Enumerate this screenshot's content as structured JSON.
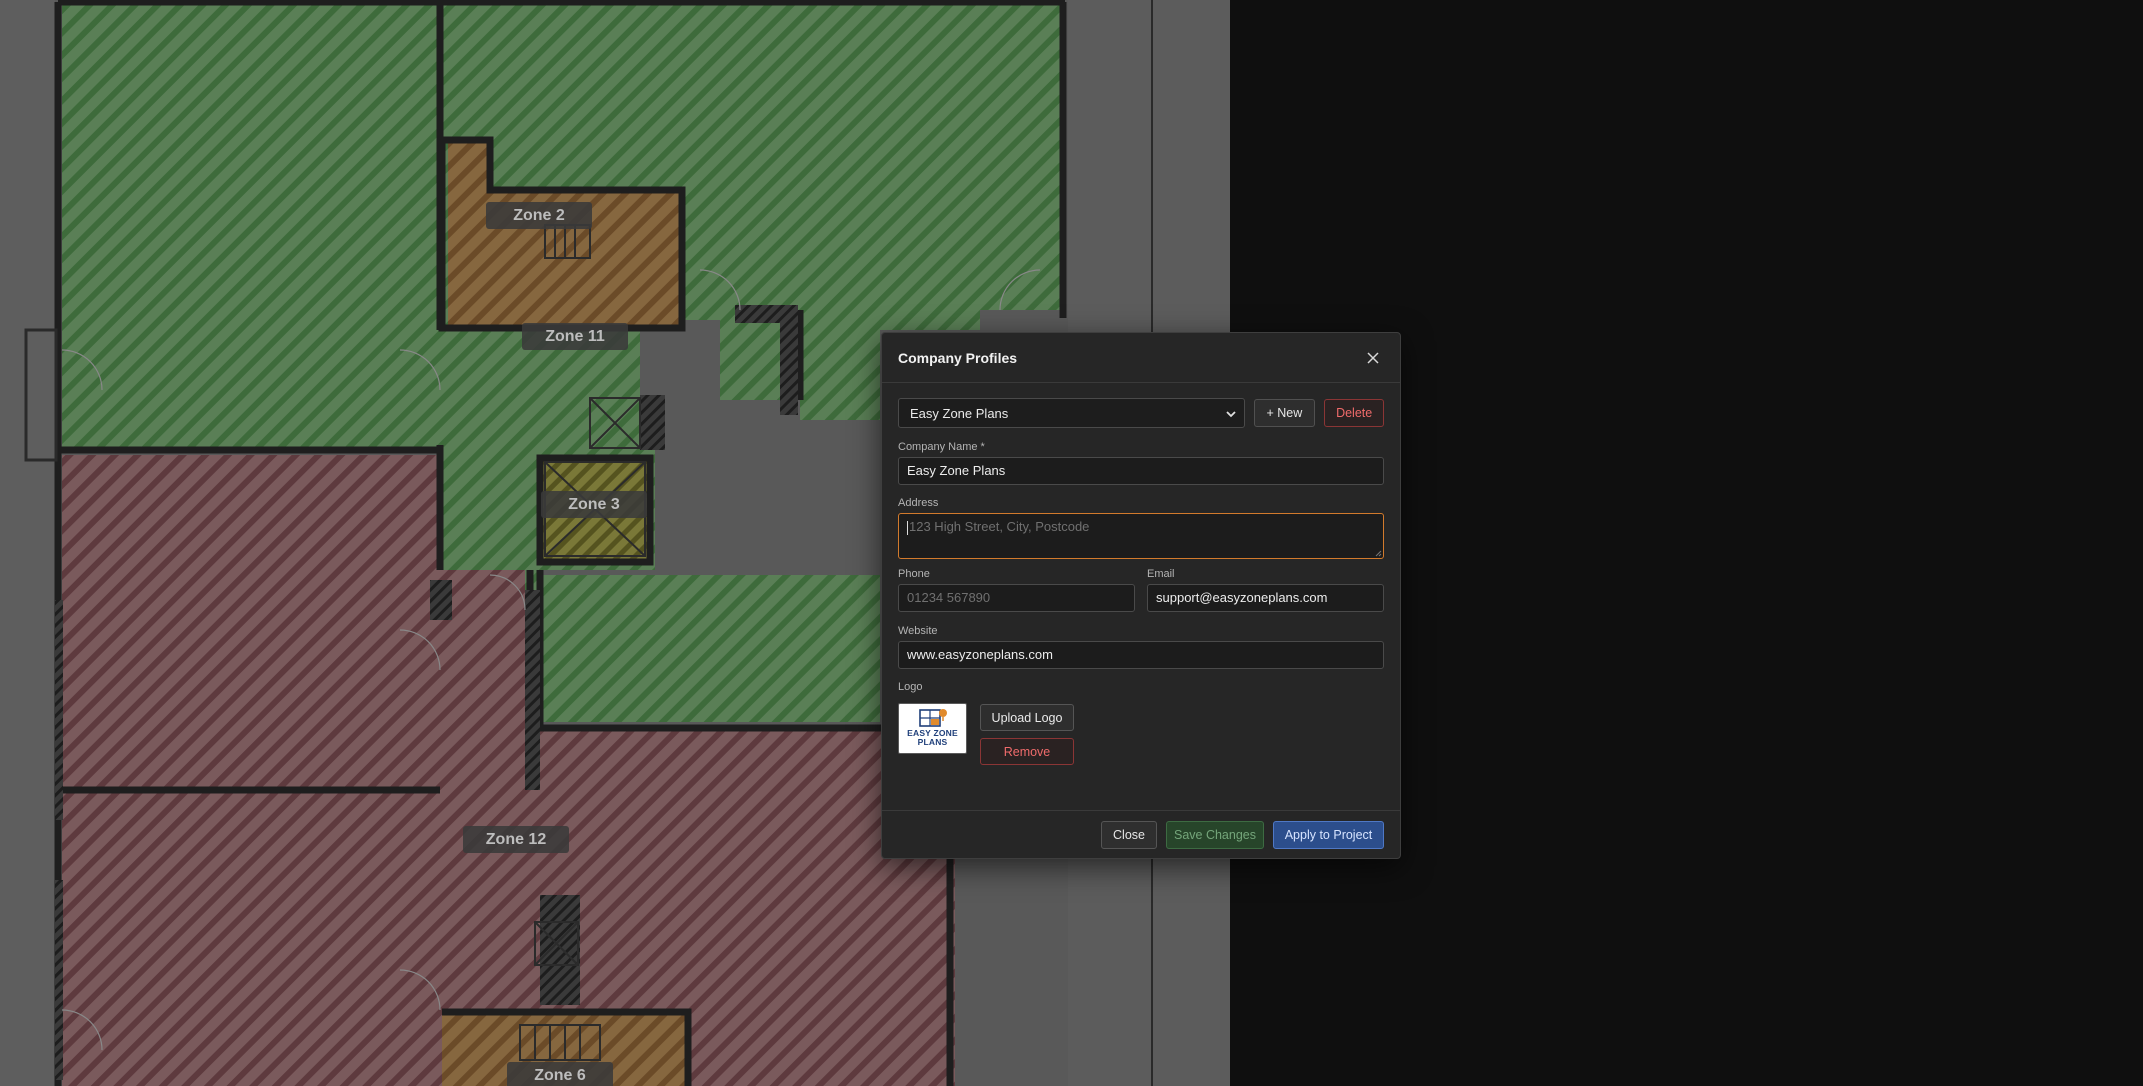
{
  "floorplan": {
    "zones": [
      {
        "label": "Zone 2"
      },
      {
        "label": "Zone 11"
      },
      {
        "label": "Zone 3"
      },
      {
        "label": "Zone 12"
      },
      {
        "label": "Zone 6"
      }
    ],
    "colors": {
      "green_zone": "#4f7a4f",
      "red_zone": "#6e4a4e",
      "orange_zone": "#7d5a36",
      "yellow_zone": "#6c6a30"
    }
  },
  "dialog": {
    "title": "Company Profiles",
    "close_icon": "close-icon",
    "profile_select": {
      "selected": "Easy Zone Plans"
    },
    "new_button": "+ New",
    "delete_button": "Delete",
    "company_name": {
      "label": "Company Name *",
      "value": "Easy Zone Plans"
    },
    "address": {
      "label": "Address",
      "placeholder": "123 High Street, City, Postcode"
    },
    "phone": {
      "label": "Phone",
      "placeholder": "01234 567890"
    },
    "email": {
      "label": "Email",
      "value": "support@easyzoneplans.com"
    },
    "website": {
      "label": "Website",
      "value": "www.easyzoneplans.com"
    },
    "logo": {
      "label": "Logo",
      "text_line1": "EASY ZONE",
      "text_line2": "PLANS",
      "upload_button": "Upload Logo",
      "remove_button": "Remove"
    },
    "footer": {
      "close_button": "Close",
      "save_button": "Save Changes",
      "apply_button": "Apply to Project"
    },
    "colors": {
      "accent_blue": "#2c4e8c",
      "danger": "#ef6b6b",
      "focus_orange": "#d27a2c",
      "save_green": "#27452a"
    }
  }
}
